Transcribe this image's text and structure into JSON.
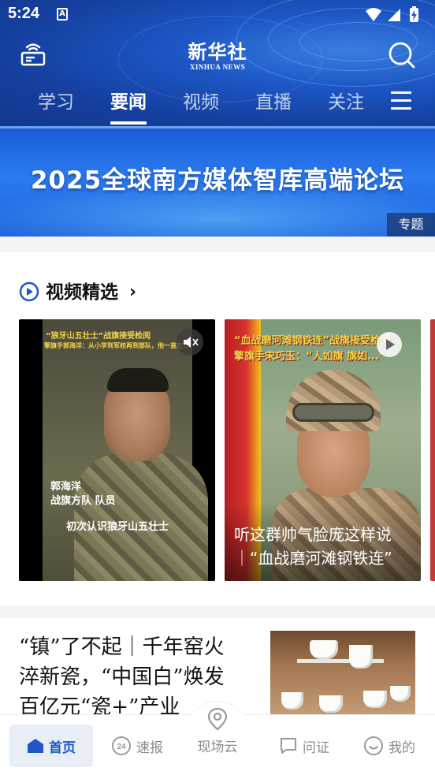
{
  "status_bar": {
    "time": "5:24",
    "notification_icon": "a-letter-icon",
    "icons": [
      "wifi-icon",
      "signal-icon",
      "battery-charging-icon"
    ]
  },
  "header": {
    "logo_cn": "新华社",
    "logo_en": "XINHUA NEWS",
    "left_icon": "radio-icon",
    "right_icon": "search-icon",
    "tabs": [
      {
        "label": "学习",
        "active": false
      },
      {
        "label": "要闻",
        "active": true
      },
      {
        "label": "视频",
        "active": false
      },
      {
        "label": "直播",
        "active": false
      },
      {
        "label": "关注",
        "active": false
      }
    ],
    "menu_icon": "hamburger-menu-icon"
  },
  "banner": {
    "title": "2025全球南方媒体智库高端论坛",
    "tag": "专题"
  },
  "video_section": {
    "title": "视频精选",
    "icon": "play-circle-icon",
    "cards": [
      {
        "overlay_top": "“狼牙山五壮士”战旗接受检阅",
        "overlay_sub": "擎旗手郭海洋：从小学到军校再到部队，他一直在...",
        "name_line1": "郭海洋",
        "name_line2": "战旗方队 队员",
        "caption": "初次认识狼牙山五壮士",
        "control_icon": "mute-icon"
      },
      {
        "overlay_top": "“血战磨河滩钢铁连”战旗接受检阅",
        "overlay_sub": "擎旗手宋巧玉：“人如旗 旗如...”",
        "caption_line1": "听这群帅气脸庞这样说",
        "caption_line2": "｜“血战磨河滩钢铁连”",
        "control_icon": "play-icon"
      }
    ]
  },
  "news": {
    "title_line1": "“镇”了不起｜千年窑火",
    "title_line2": "淬新瓷，“中国白”焕发",
    "title_line3": "百亿元“瓷+”产业"
  },
  "bottom_nav": [
    {
      "label": "首页",
      "icon": "home-icon",
      "active": true
    },
    {
      "label": "速报",
      "icon": "24-hour-icon",
      "active": false
    },
    {
      "label": "现场云",
      "icon": "location-pin-icon",
      "active": false
    },
    {
      "label": "问证",
      "icon": "chat-bubble-icon",
      "active": false
    },
    {
      "label": "我的",
      "icon": "smiley-profile-icon",
      "active": false
    }
  ],
  "colors": {
    "header_blue": "#1c56c4",
    "accent_blue": "#1f57c9",
    "nav_inactive": "#8c8c8c",
    "caption_yellow": "#f2d34a"
  }
}
